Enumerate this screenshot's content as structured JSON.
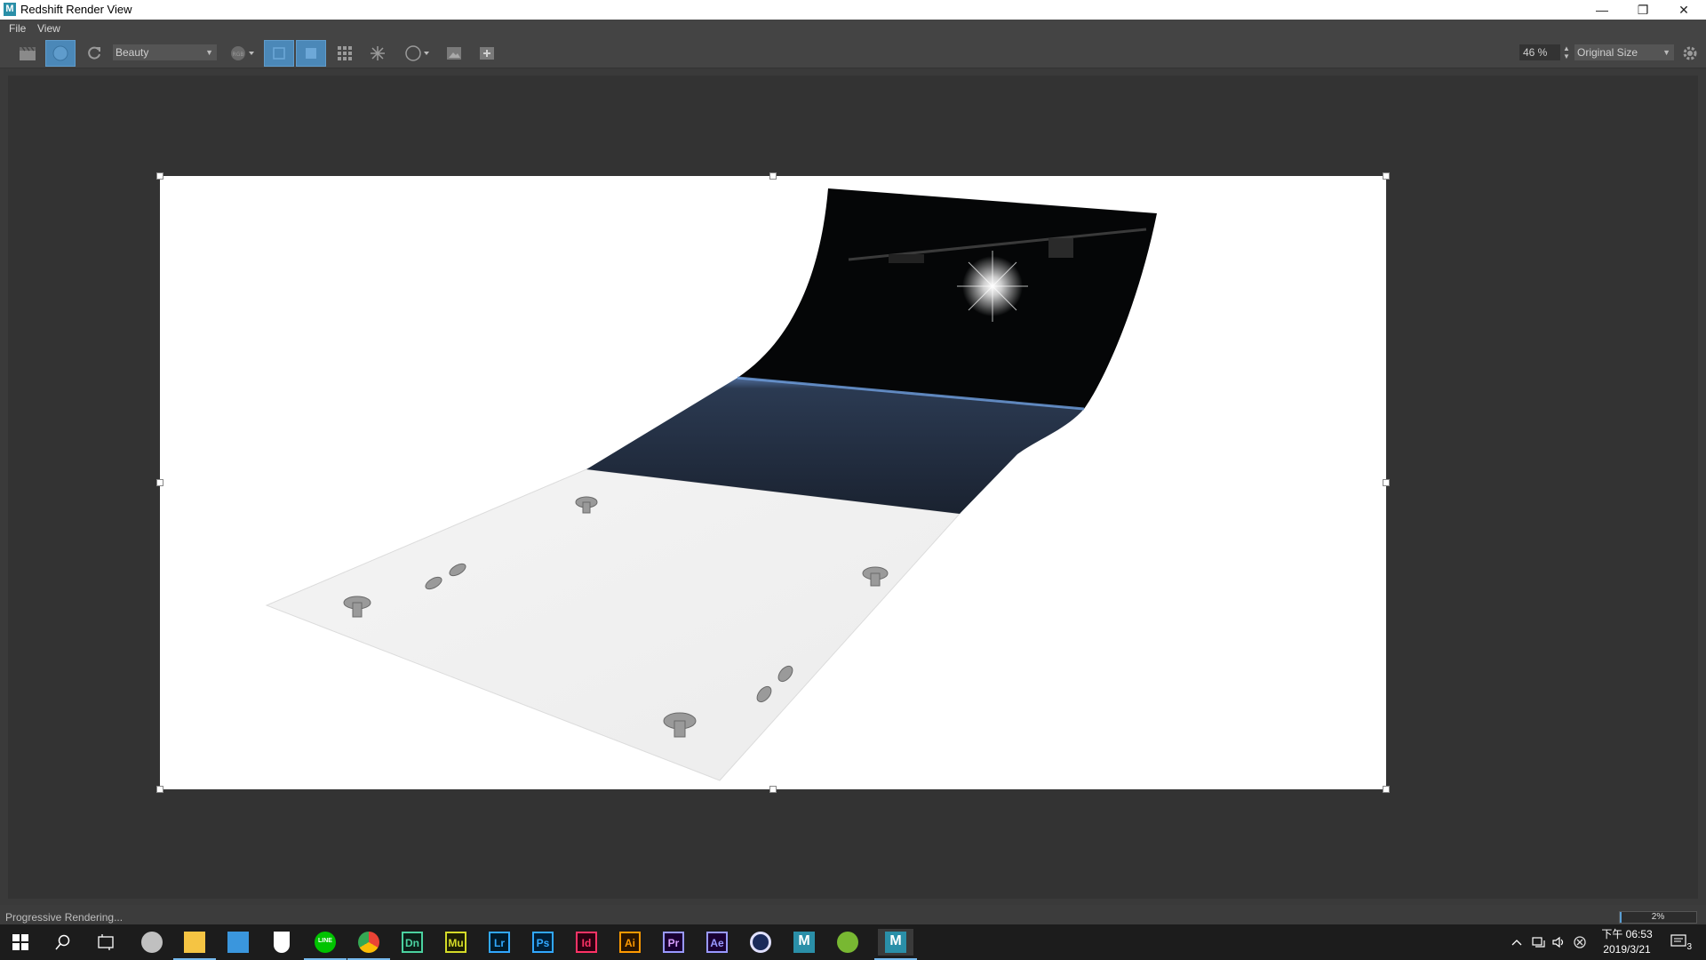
{
  "window": {
    "title": "Redshift Render View",
    "app_icon_letter": "M",
    "controls": {
      "minimize": "—",
      "maximize": "❐",
      "close": "✕"
    }
  },
  "menu": {
    "items": [
      "File",
      "View"
    ]
  },
  "toolbar": {
    "aov_select": "Beauty",
    "zoom_value": "46 %",
    "size_select": "Original Size",
    "icons": [
      "clapperboard-icon",
      "render-icon",
      "refresh-icon",
      "rgb-channel-icon",
      "crop-region-icon",
      "fit-icon",
      "grid-icon",
      "snowflake-icon",
      "circle-icon",
      "snapshot-icon",
      "add-snapshot-icon",
      "settings-icon"
    ]
  },
  "status": {
    "message": "Progressive Rendering...",
    "progress_text": "2%",
    "progress_value": 0.02
  },
  "taskbar": {
    "apps": [
      {
        "name": "chrome-remote",
        "label": ""
      },
      {
        "name": "file-explorer",
        "label": ""
      },
      {
        "name": "store",
        "label": ""
      },
      {
        "name": "defender",
        "label": ""
      },
      {
        "name": "line",
        "label": "LINE"
      },
      {
        "name": "chrome",
        "label": ""
      },
      {
        "name": "dimension",
        "label": "Dn"
      },
      {
        "name": "muse",
        "label": "Mu"
      },
      {
        "name": "lightroom",
        "label": "Lr"
      },
      {
        "name": "photoshop",
        "label": "Ps"
      },
      {
        "name": "indesign",
        "label": "Id"
      },
      {
        "name": "illustrator",
        "label": "Ai"
      },
      {
        "name": "premiere",
        "label": "Pr"
      },
      {
        "name": "after-effects",
        "label": "Ae"
      },
      {
        "name": "cinema4d",
        "label": ""
      },
      {
        "name": "maya",
        "label": "M"
      },
      {
        "name": "utorrent",
        "label": ""
      },
      {
        "name": "maya-active",
        "label": "M"
      }
    ],
    "clock_time": "下午 06:53",
    "clock_date": "2019/3/21",
    "notification_count": "3"
  },
  "colors": {
    "accent": "#4b88b8",
    "ps": "#31a8ff",
    "ai": "#ff9a00",
    "id": "#ff3366",
    "pr": "#9999ff",
    "ae": "#9999ff",
    "lr": "#31a8ff",
    "mu": "#d4db28",
    "dn": "#4bd2a0"
  }
}
